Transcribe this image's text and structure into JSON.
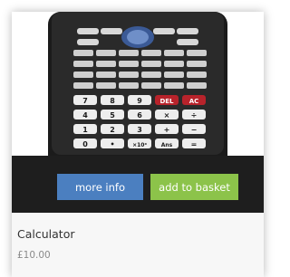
{
  "product": {
    "image_alt": "Calculator",
    "name": "Calculator",
    "price": "£10.00"
  },
  "calculator_keys": {
    "row1": [
      "7",
      "8",
      "9",
      "DEL",
      "AC"
    ],
    "row2": [
      "4",
      "5",
      "6",
      "×",
      "÷"
    ],
    "row3": [
      "1",
      "2",
      "3",
      "+",
      "−"
    ],
    "row4": [
      "0",
      "•",
      "×10ˣ",
      "Ans",
      "="
    ]
  },
  "buttons": {
    "more_info": "more info",
    "add_to_basket": "add to basket"
  },
  "colors": {
    "more_info_bg": "#4b7fc0",
    "add_to_basket_bg": "#8cc34a",
    "overlay_bg": "#1e1e1e",
    "del_ac_key": "#b8232b"
  },
  "icons": [
    "calculator-image"
  ]
}
